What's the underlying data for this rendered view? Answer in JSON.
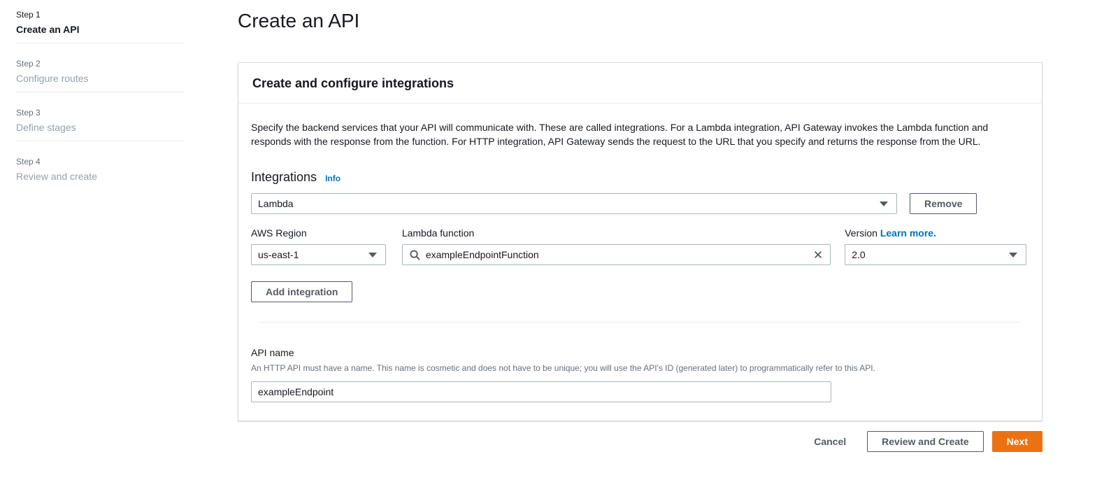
{
  "page": {
    "title": "Create an API"
  },
  "steps": [
    {
      "step": "Step 1",
      "label": "Create an API",
      "active": true
    },
    {
      "step": "Step 2",
      "label": "Configure routes",
      "active": false
    },
    {
      "step": "Step 3",
      "label": "Define stages",
      "active": false
    },
    {
      "step": "Step 4",
      "label": "Review and create",
      "active": false
    }
  ],
  "card": {
    "header": "Create and configure integrations",
    "description": "Specify the backend services that your API will communicate with. These are called integrations. For a Lambda integration, API Gateway invokes the Lambda function and responds with the response from the function. For HTTP integration, API Gateway sends the request to the URL that you specify and returns the response from the URL.",
    "integrations": {
      "heading": "Integrations",
      "info_link": "Info",
      "type_value": "Lambda",
      "remove_button": "Remove",
      "aws_region": {
        "label": "AWS Region",
        "value": "us-east-1"
      },
      "lambda_function": {
        "label": "Lambda function",
        "value": "exampleEndpointFunction"
      },
      "version": {
        "label": "Version",
        "learn_more": "Learn more.",
        "value": "2.0"
      },
      "add_button": "Add integration"
    },
    "api_name": {
      "label": "API name",
      "helper": "An HTTP API must have a name. This name is cosmetic and does not have to be unique; you will use the API's ID (generated later) to programmatically refer to this API.",
      "value": "exampleEndpoint"
    }
  },
  "footer": {
    "cancel": "Cancel",
    "review": "Review and Create",
    "next": "Next"
  },
  "colors": {
    "primary_orange": "#ec7211",
    "link_blue": "#0073bb",
    "text_dark": "#16191f",
    "text_muted": "#687078",
    "border_gray": "#aab7b8"
  }
}
